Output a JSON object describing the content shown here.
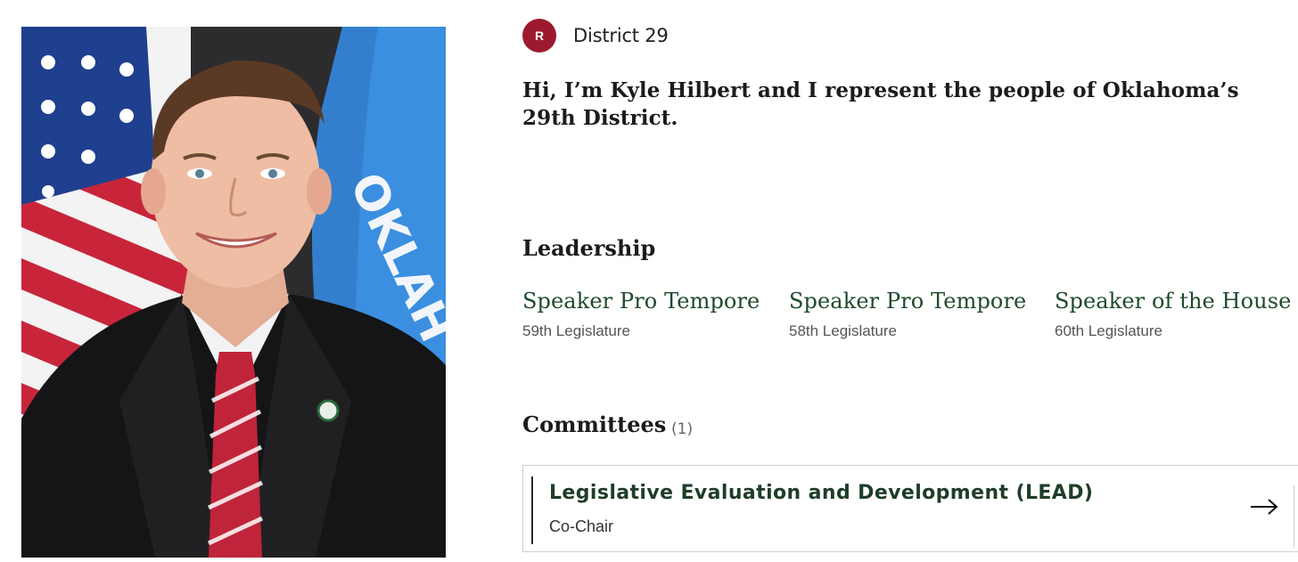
{
  "profile": {
    "party_initial": "R",
    "district": "District 29",
    "intro": "Hi, I’m Kyle Hilbert and I represent the people of Oklahoma’s 29th District.",
    "flag_text": "OKLAH"
  },
  "leadership": {
    "heading": "Leadership",
    "roles": [
      {
        "title": "Speaker Pro Tempore",
        "legislature": "59th Legislature"
      },
      {
        "title": "Speaker Pro Tempore",
        "legislature": "58th Legislature"
      },
      {
        "title": "Speaker of the House",
        "legislature": "60th Legislature"
      }
    ]
  },
  "committees": {
    "heading": "Committees",
    "count": "(1)",
    "items": [
      {
        "name": "Legislative Evaluation and Development (LEAD)",
        "role": "Co-Chair",
        "icon": "arrow-right-icon"
      }
    ]
  },
  "colors": {
    "party_red": "#9d1a2e",
    "title_green": "#1f4a2a",
    "flag_blue": "#3b8fe0"
  }
}
